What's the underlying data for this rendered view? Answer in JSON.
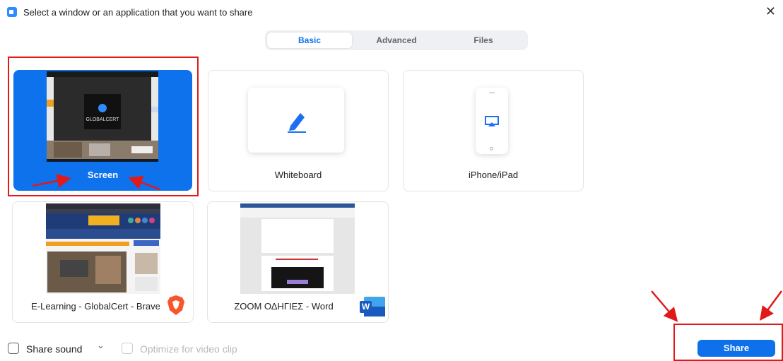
{
  "window": {
    "title": "Select a window or an application that you want to share",
    "close_glyph": "✕"
  },
  "tabs": [
    {
      "label": "Basic",
      "active": true
    },
    {
      "label": "Advanced",
      "active": false
    },
    {
      "label": "Files",
      "active": false
    }
  ],
  "tiles": {
    "screen": {
      "label": "Screen",
      "selected": true
    },
    "whiteboard": {
      "label": "Whiteboard"
    },
    "iphone": {
      "label": "iPhone/iPad"
    },
    "brave": {
      "label": "E-Learning - GlobalCert - Brave",
      "app_icon": "brave-icon"
    },
    "word": {
      "label": "ZOOM ΟΔΗΓΙΕΣ - Word",
      "app_icon": "word-icon",
      "app_icon_letter": "W"
    }
  },
  "thumbnail_text": {
    "globalcert_logo": "GLOBALCERT"
  },
  "bottom": {
    "share_sound_label": "Share sound",
    "share_sound_checked": false,
    "dropdown_glyph": "⌄",
    "optimize_label": "Optimize for video clip",
    "optimize_enabled": false,
    "share_button_label": "Share"
  },
  "colors": {
    "accent": "#0e71eb",
    "selected_tile": "#0e72ed",
    "annotation_red": "#e01a1a"
  }
}
